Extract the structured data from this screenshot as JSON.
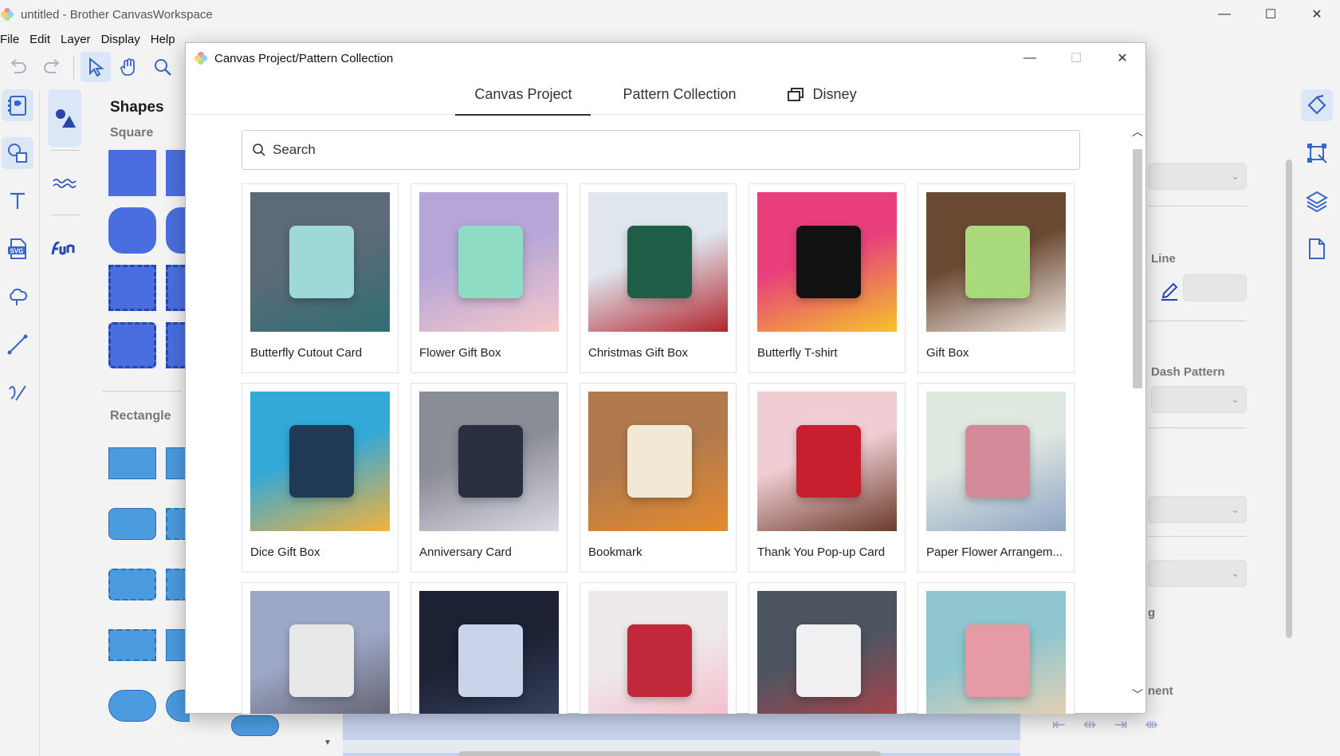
{
  "app": {
    "title": "untitled - Brother CanvasWorkspace",
    "menu": [
      "File",
      "Edit",
      "Layer",
      "Display",
      "Help"
    ]
  },
  "shapes_panel": {
    "title": "Shapes",
    "sections": [
      "Square",
      "Rectangle"
    ]
  },
  "right_panel": {
    "line_label": "Line",
    "dash_label": "Dash Pattern",
    "partial_label_1": "g",
    "partial_label_2": "nent"
  },
  "dialog": {
    "title": "Canvas Project/Pattern Collection",
    "tabs": [
      {
        "label": "Canvas Project",
        "active": true
      },
      {
        "label": "Pattern Collection",
        "active": false
      },
      {
        "label": "Disney",
        "active": false,
        "icon": "gallery-icon"
      }
    ],
    "search": {
      "placeholder": "Search",
      "value": ""
    },
    "projects": [
      {
        "label": "Butterfly Cutout Card",
        "colors": [
          "#5d6a78",
          "#9fd8d8",
          "#2f6f73"
        ]
      },
      {
        "label": "Flower Gift Box",
        "colors": [
          "#b6a6d8",
          "#8fdcc4",
          "#f6c8c9"
        ]
      },
      {
        "label": "Christmas Gift Box",
        "colors": [
          "#dfe6ee",
          "#1e5e46",
          "#b3242d"
        ]
      },
      {
        "label": "Butterfly T-shirt",
        "colors": [
          "#e83e7c",
          "#111111",
          "#f4c42a"
        ]
      },
      {
        "label": "Gift Box",
        "colors": [
          "#6b4a34",
          "#a8d97a",
          "#f1e9e0"
        ]
      },
      {
        "label": "Dice Gift Box",
        "colors": [
          "#33a9d8",
          "#1f3a55",
          "#f3b23b"
        ]
      },
      {
        "label": "Anniversary Card",
        "colors": [
          "#8b8d96",
          "#2b3040",
          "#d9d9e3"
        ]
      },
      {
        "label": "Bookmark",
        "colors": [
          "#b07a4c",
          "#f1e8d5",
          "#e58a2e"
        ]
      },
      {
        "label": "Thank You Pop-up Card",
        "colors": [
          "#f0cdd2",
          "#c81f2e",
          "#6a3b2a"
        ]
      },
      {
        "label": "Paper Flower Arrangem...",
        "colors": [
          "#dfe7e1",
          "#d58a9a",
          "#8fa6c4"
        ]
      },
      {
        "label": "",
        "colors": [
          "#9da7c6",
          "#e8e8e8",
          "#5a5a64"
        ]
      },
      {
        "label": "",
        "colors": [
          "#1c2233",
          "#c9d3ea",
          "#3a4666"
        ]
      },
      {
        "label": "",
        "colors": [
          "#eeeaea",
          "#c2283b",
          "#f5b7c6"
        ]
      },
      {
        "label": "",
        "colors": [
          "#4d5561",
          "#f0f0f2",
          "#b64047"
        ]
      },
      {
        "label": "",
        "colors": [
          "#8fc6cf",
          "#e69aa6",
          "#f3d1b0"
        ]
      }
    ]
  }
}
